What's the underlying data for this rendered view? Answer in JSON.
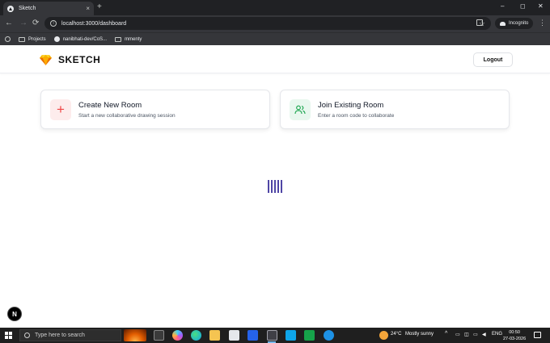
{
  "browser": {
    "tab_title": "Sketch",
    "tab_close": "×",
    "new_tab": "+",
    "url": "localhost:3000/dashboard",
    "incognito_label": "Incognito",
    "bookmarks": [
      "Projects",
      "nanibhati-dev/CoS...",
      "mmenty"
    ],
    "window_controls": [
      "–",
      "◻",
      "✕"
    ],
    "nav": [
      "←",
      "→",
      "⟳"
    ]
  },
  "app": {
    "logo_text": "SKETCH",
    "logout_label": "Logout",
    "create_card": {
      "title": "Create New Room",
      "subtitle": "Start a new collaborative drawing session",
      "icon": "+"
    },
    "join_card": {
      "title": "Join Existing Room",
      "subtitle": "Enter a room code to collaborate"
    },
    "next_badge": "N"
  },
  "taskbar": {
    "search_placeholder": "Type here to search",
    "weather_temp": "24°C",
    "weather_desc": "Mostly sunny",
    "lang": "ENG",
    "time": "00:50",
    "date": "27-03-2026"
  }
}
